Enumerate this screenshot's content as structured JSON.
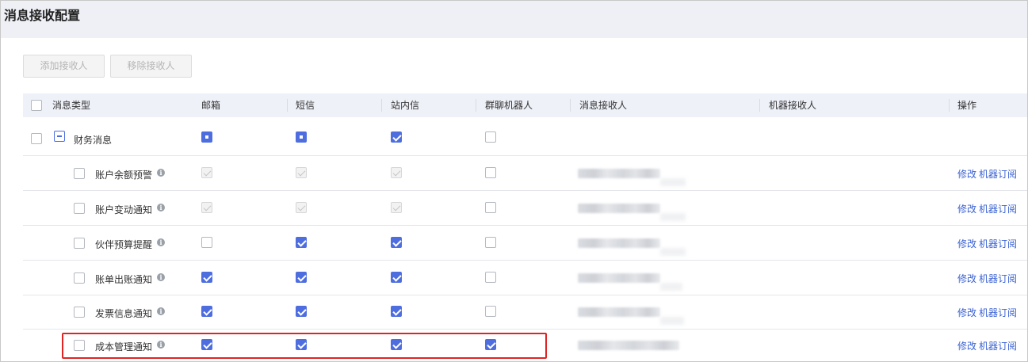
{
  "page": {
    "title": "消息接收配置"
  },
  "toolbar": {
    "add_label": "添加接收人",
    "remove_label": "移除接收人"
  },
  "table": {
    "columns": [
      "消息类型",
      "邮箱",
      "短信",
      "站内信",
      "群聊机器人",
      "消息接收人",
      "机器接收人",
      "操作"
    ],
    "group": {
      "label": "财务消息",
      "email": "partial",
      "sms": "partial",
      "inbox": "checked",
      "bot": "unchecked"
    },
    "rows": [
      {
        "label": "账户余额预警",
        "email": "disabled",
        "sms": "disabled",
        "inbox": "disabled",
        "bot": "unchecked",
        "edit": "修改",
        "subscribe": "机器订阅"
      },
      {
        "label": "账户变动通知",
        "email": "disabled",
        "sms": "disabled",
        "inbox": "disabled",
        "bot": "unchecked",
        "edit": "修改",
        "subscribe": "机器订阅"
      },
      {
        "label": "伙伴预算提醒",
        "email": "unchecked",
        "sms": "checked",
        "inbox": "checked",
        "bot": "unchecked",
        "edit": "修改",
        "subscribe": "机器订阅"
      },
      {
        "label": "账单出账通知",
        "email": "checked",
        "sms": "checked",
        "inbox": "checked",
        "bot": "unchecked",
        "edit": "修改",
        "subscribe": "机器订阅"
      },
      {
        "label": "发票信息通知",
        "email": "checked",
        "sms": "checked",
        "inbox": "checked",
        "bot": "unchecked",
        "edit": "修改",
        "subscribe": "机器订阅"
      },
      {
        "label": "成本管理通知",
        "email": "checked",
        "sms": "checked",
        "inbox": "checked",
        "bot": "checked",
        "edit": "修改",
        "subscribe": "机器订阅"
      }
    ]
  },
  "colors": {
    "accent": "#4e6ee0",
    "link": "#3a62d2",
    "highlight": "#e02424",
    "header_bg": "#eef1f8"
  },
  "icons": {
    "info": "info-icon",
    "collapse": "minus-square-icon"
  }
}
